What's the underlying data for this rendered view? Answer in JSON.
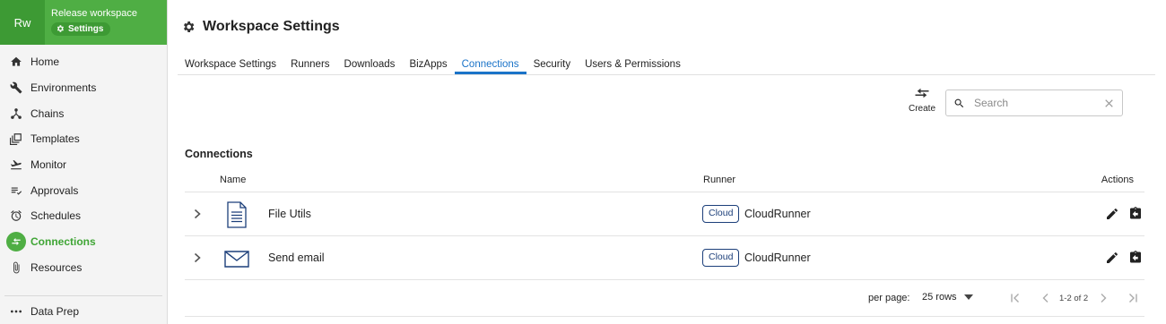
{
  "workspace": {
    "initials": "Rw",
    "name": "Release workspace",
    "badge_label": "Settings"
  },
  "sidebar": {
    "items": [
      {
        "label": "Home",
        "icon": "home-icon"
      },
      {
        "label": "Environments",
        "icon": "wrench-icon"
      },
      {
        "label": "Chains",
        "icon": "chains-icon"
      },
      {
        "label": "Templates",
        "icon": "templates-icon"
      },
      {
        "label": "Monitor",
        "icon": "monitor-icon"
      },
      {
        "label": "Approvals",
        "icon": "approvals-icon"
      },
      {
        "label": "Schedules",
        "icon": "alarm-clock-icon"
      },
      {
        "label": "Connections",
        "icon": "connections-icon",
        "active": true
      },
      {
        "label": "Resources",
        "icon": "paperclip-icon"
      }
    ],
    "bottom_item": {
      "label": "Data Prep",
      "icon": "dots-icon"
    }
  },
  "page": {
    "title": "Workspace Settings"
  },
  "tabs": [
    {
      "label": "Workspace Settings"
    },
    {
      "label": "Runners"
    },
    {
      "label": "Downloads"
    },
    {
      "label": "BizApps"
    },
    {
      "label": "Connections",
      "active": true
    },
    {
      "label": "Security"
    },
    {
      "label": "Users & Permissions"
    }
  ],
  "toolbar": {
    "create_label": "Create",
    "search_placeholder": "Search",
    "search_value": ""
  },
  "connections": {
    "section_title": "Connections",
    "columns": {
      "name": "Name",
      "runner": "Runner",
      "actions": "Actions"
    },
    "rows": [
      {
        "name": "File Utils",
        "icon": "document-icon",
        "runner_badge": "Cloud",
        "runner": "CloudRunner"
      },
      {
        "name": "Send email",
        "icon": "envelope-icon",
        "runner_badge": "Cloud",
        "runner": "CloudRunner"
      }
    ]
  },
  "pagination": {
    "per_page_label": "per page:",
    "rows_value": "25 rows",
    "range": "1-2 of 2"
  },
  "colors": {
    "brand_green": "#4fae44",
    "active_tab_blue": "#1a73c8",
    "badge_navy": "#1c3f7a"
  }
}
